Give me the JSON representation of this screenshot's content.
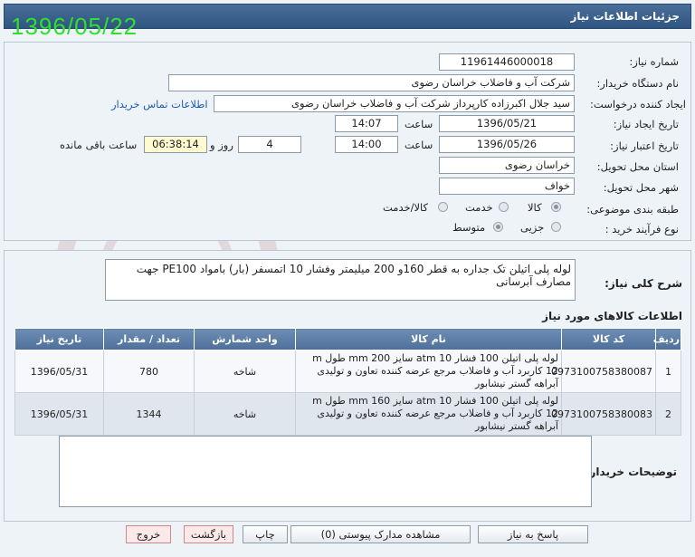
{
  "header": {
    "title": "جزئیات اطلاعات نیاز",
    "date_stamp": "1396/05/22"
  },
  "form": {
    "need_number": {
      "label": "شماره نیاز:",
      "value": "11961446000018"
    },
    "buyer_org": {
      "label": "نام دستگاه خریدار:",
      "value": "شرکت آب و فاضلاب خراسان رضوی"
    },
    "requester": {
      "label": "ایجاد کننده درخواست:",
      "value": "سید جلال اکبرزاده کارپرداز شرکت آب و فاضلاب خراسان رضوی",
      "contact_link": "اطلاعات تماس خریدار"
    },
    "created": {
      "label": "تاریخ ایجاد نیاز:",
      "date": "1396/05/21",
      "time_label": "ساعت",
      "time": "14:07"
    },
    "deadline": {
      "label": "تاریخ اعتبار نیاز:",
      "date": "1396/05/26",
      "time_label": "ساعت",
      "time": "14:00",
      "days": "4",
      "days_label": "روز و",
      "remaining": "06:38:14",
      "remaining_label": "ساعت باقی مانده"
    },
    "province": {
      "label": "استان محل تحویل:",
      "value": "خراسان رضوی"
    },
    "city": {
      "label": "شهر محل تحویل:",
      "value": "خواف"
    },
    "category": {
      "label": "طبقه بندی موضوعی:",
      "options": [
        "کالا",
        "خدمت",
        "کالا/خدمت"
      ],
      "selected": "کالا"
    },
    "purchase_type": {
      "label": "نوع فرآیند خرید :",
      "options": [
        "جزیی",
        "متوسط"
      ],
      "selected": "متوسط"
    }
  },
  "summary": {
    "label": "شرح کلی نیاز:",
    "value": "لوله پلی اتیلن تک جداره به قطر 160و 200 میلیمتر وفشار 10 اتمسفر (بار) بامواد PE100 جهت مصارف آبرسانی"
  },
  "items": {
    "title": "اطلاعات کالاهای مورد نیاز",
    "columns": [
      "ردیف",
      "کد کالا",
      "نام کالا",
      "واحد شمارش",
      "تعداد / مقدار",
      "تاریخ نیاز"
    ],
    "rows": [
      {
        "row": "1",
        "code": "0973100758380087",
        "name": "لوله پلی اتیلن 100 فشار atm 10 سایز mm 200 طول m 12 کاربرد آب و فاضلاب مرجع عرضه کننده تعاون و تولیدی آبراهه گستر نیشابور",
        "unit": "شاخه",
        "qty": "780",
        "date": "1396/05/31"
      },
      {
        "row": "2",
        "code": "0973100758380083",
        "name": "لوله پلی اتیلن 100 فشار atm 10 سایز mm 160 طول m 12 کاربرد آب و فاضلاب مرجع عرضه کننده تعاون و تولیدی آبراهه گستر نیشابور",
        "unit": "شاخه",
        "qty": "1344",
        "date": "1396/05/31"
      }
    ]
  },
  "buyer_notes": {
    "label": "توضیحات خریدار:",
    "value": ""
  },
  "buttons": {
    "reply": "پاسخ به نیاز",
    "attachments": "مشاهده مدارک پیوستی (0)",
    "print": "چاپ",
    "back": "بازگشت",
    "exit": "خروج"
  },
  "colors": {
    "header_bg": "#2f5581",
    "table_header_bg": "#5b7ca5",
    "stamp_green": "#2ee02e",
    "link_blue": "#1f5bb5"
  }
}
